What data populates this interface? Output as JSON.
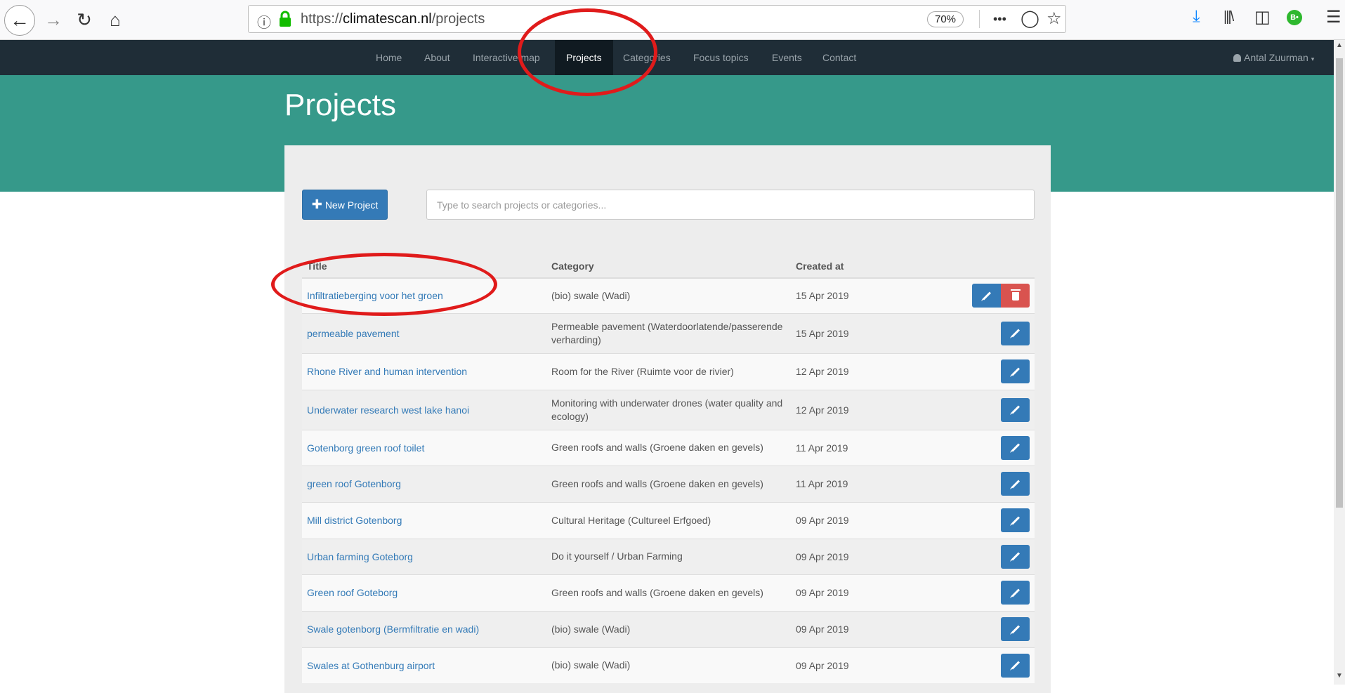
{
  "browser": {
    "url_prefix": "https://",
    "url_host": "climatescan.nl",
    "url_path": "/projects",
    "zoom": "70%",
    "more_icon": "•••",
    "badge": "B•"
  },
  "nav": {
    "links": [
      "Home",
      "About",
      "Interactive map",
      "Projects",
      "Categories",
      "Focus topics",
      "Events",
      "Contact"
    ],
    "active": "Projects",
    "user": "Antal Zuurman",
    "user_caret": "▾"
  },
  "page": {
    "title": "Projects",
    "new_button": "New Project",
    "search_placeholder": "Type to search projects or categories..."
  },
  "table": {
    "headers": [
      "Title",
      "Category",
      "Created at"
    ],
    "rows": [
      {
        "title": "Infiltratieberging voor het groen",
        "category": "(bio) swale (Wadi)",
        "date": "15 Apr 2019",
        "deletable": true
      },
      {
        "title": "permeable pavement",
        "category": "Permeable pavement (Waterdoorlatende/passerende verharding)",
        "date": "15 Apr 2019",
        "deletable": false
      },
      {
        "title": "Rhone River and human intervention",
        "category": "Room for the River (Ruimte voor de rivier)",
        "date": "12 Apr 2019",
        "deletable": false
      },
      {
        "title": "Underwater research west lake hanoi",
        "category": "Monitoring with underwater drones (water quality and ecology)",
        "date": "12 Apr 2019",
        "deletable": false
      },
      {
        "title": "Gotenborg green roof toilet",
        "category": "Green roofs and walls (Groene daken en gevels)",
        "date": "11 Apr 2019",
        "deletable": false
      },
      {
        "title": "green roof Gotenborg",
        "category": "Green roofs and walls (Groene daken en gevels)",
        "date": "11 Apr 2019",
        "deletable": false
      },
      {
        "title": "Mill district Gotenborg",
        "category": "Cultural Heritage (Cultureel Erfgoed)",
        "date": "09 Apr 2019",
        "deletable": false
      },
      {
        "title": "Urban farming Goteborg",
        "category": "Do it yourself / Urban Farming",
        "date": "09 Apr 2019",
        "deletable": false
      },
      {
        "title": "Green roof Goteborg",
        "category": "Green roofs and walls (Groene daken en gevels)",
        "date": "09 Apr 2019",
        "deletable": false
      },
      {
        "title": "Swale gotenborg (Bermfiltratie en wadi)",
        "category": "(bio) swale (Wadi)",
        "date": "09 Apr 2019",
        "deletable": false
      },
      {
        "title": "Swales at Gothenburg airport",
        "category": "(bio) swale (Wadi)",
        "date": "09 Apr 2019",
        "deletable": false
      }
    ]
  },
  "colors": {
    "navbar": "#1f2d37",
    "hero": "#36998a",
    "primary": "#347ab7",
    "danger": "#d9534f",
    "annotation": "#e01b1b"
  }
}
